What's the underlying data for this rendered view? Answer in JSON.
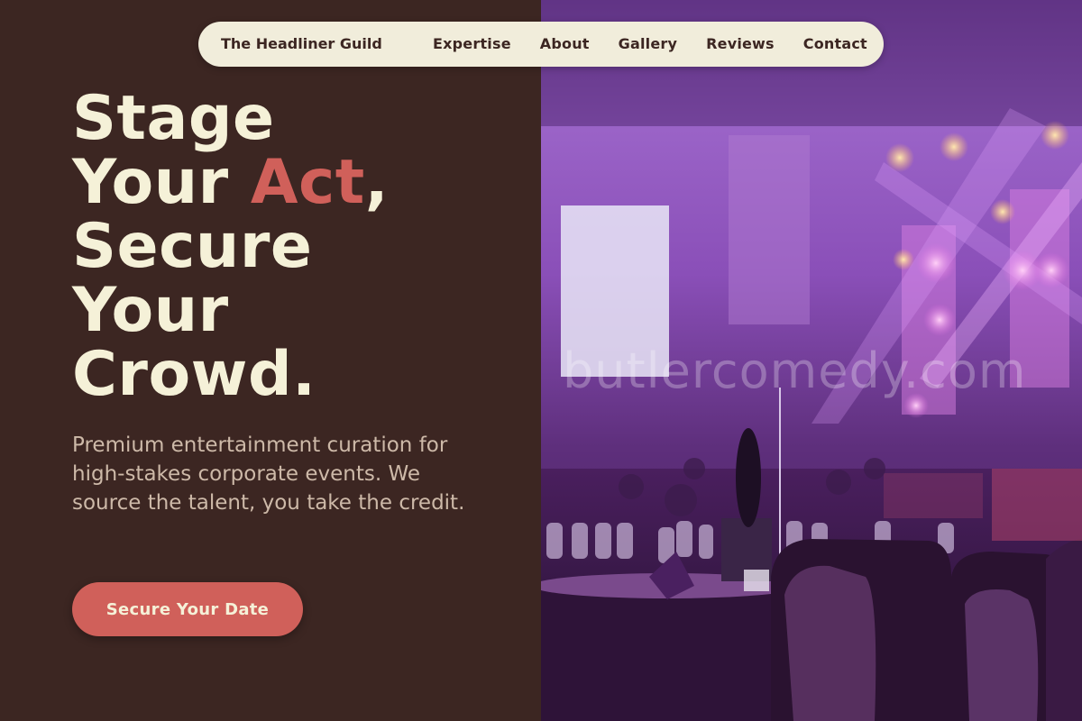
{
  "nav": {
    "brand": "The Headliner Guild",
    "links": [
      "Expertise",
      "About",
      "Gallery",
      "Reviews",
      "Contact"
    ]
  },
  "hero": {
    "headline_line1": "Stage",
    "headline_line2_pre": "Your ",
    "headline_line2_accent": "Act",
    "headline_line2_post": ",",
    "headline_line3": "Secure",
    "headline_line4": "Your",
    "headline_line5": "Crowd.",
    "subtext": "Premium entertainment curation for high-stakes corporate events. We source the talent, you take the credit.",
    "cta_label": "Secure Your Date"
  },
  "photo": {
    "description_icon": "event-hall-photo",
    "watermark": "butlercomedy.com"
  },
  "colors": {
    "background": "#3c2622",
    "nav_bg": "#f1eddb",
    "headline": "#f5f1d8",
    "accent": "#d0605a",
    "subtext": "#cdb9a8"
  }
}
